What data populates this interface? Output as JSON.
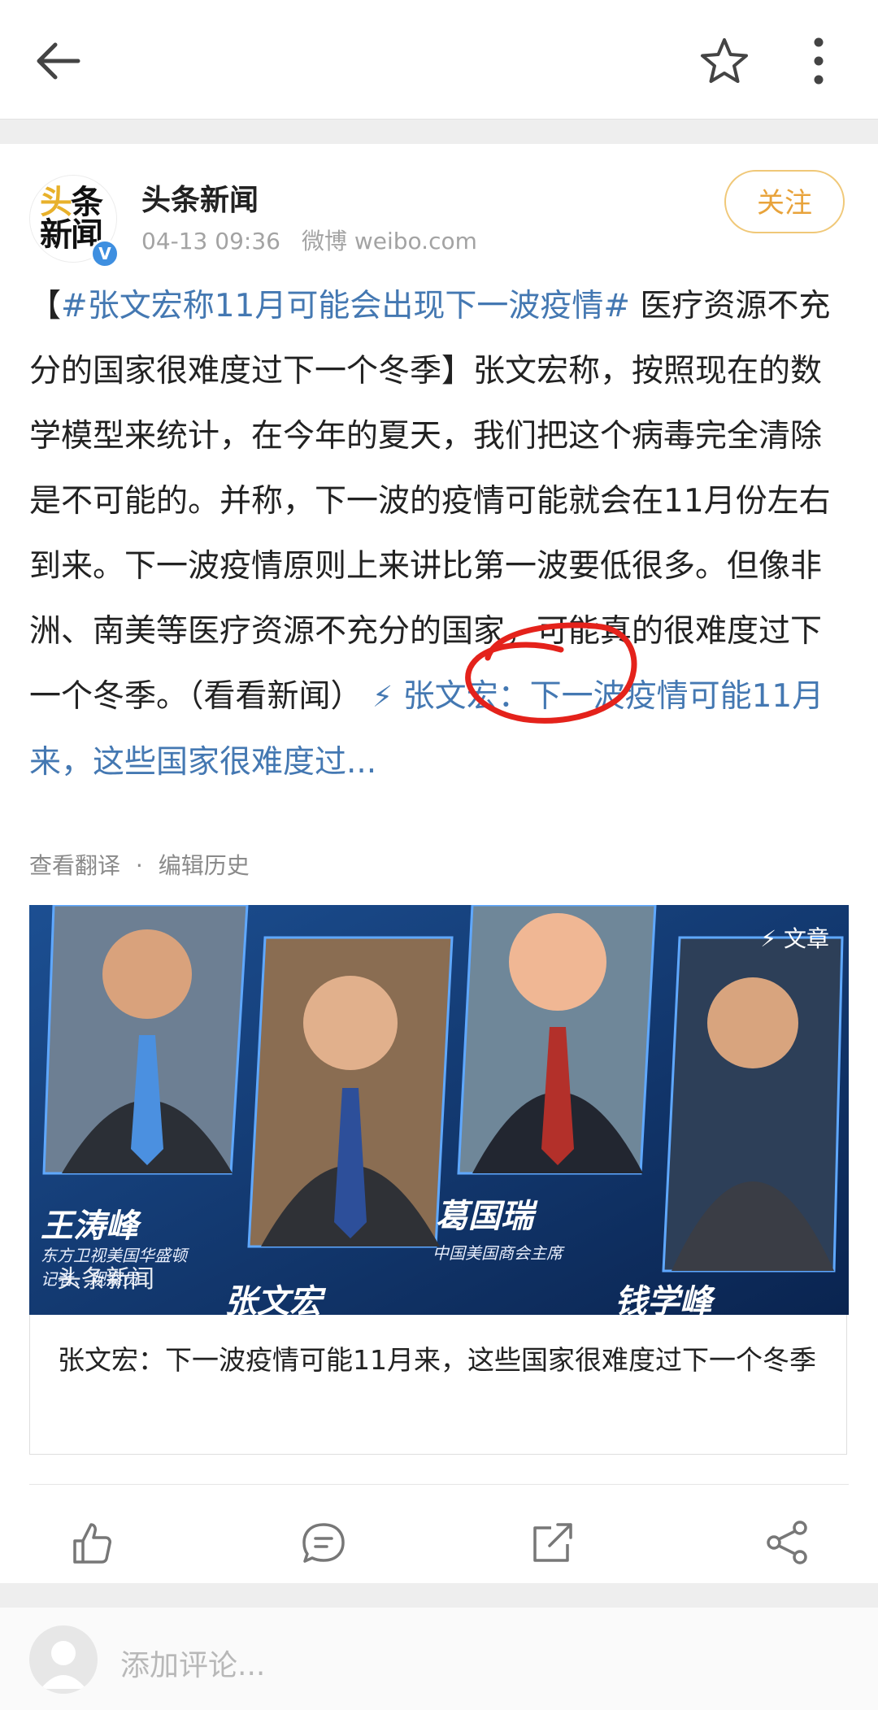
{
  "nav": {
    "back_icon": "arrow-left-icon",
    "favorite_icon": "star-icon",
    "more_icon": "more-vertical-icon"
  },
  "account": {
    "logo_line1_a": "头",
    "logo_line1_b": "条",
    "logo_line2": "新闻",
    "verified_badge": "V",
    "name": "头条新闻",
    "time": "04-13 09:36",
    "source": "微博 weibo.com",
    "follow_label": "关注"
  },
  "post": {
    "bracket_open": "【",
    "topic": "#张文宏称11月可能会出现下一波疫情#",
    "body": " 医疗资源不充分的国家很难度过下一个冬季】张文宏称，按照现在的数学模型来统计，在今年的夏天，我们把这个病毒完全清除是不可能的。并称，下一波的疫情可能就会在11月份左右到来。下一波疫情原则上来讲比第一波要低很多。但像非洲、南美等医疗资源不充分的国家，可能真的很难度过下一个冬季。（看看新闻） ",
    "link_text": "张文宏：下一波疫情可能11月来，这些国家很难度过..."
  },
  "post_actions": {
    "translate": "查看翻译",
    "separator": "·",
    "history": "编辑历史"
  },
  "card": {
    "tag": "文章",
    "names": [
      "王涛峰",
      "张文宏",
      "葛国瑞",
      "钱学峰"
    ],
    "roles": [
      "东方卫视美国华盛顿记者、观察员",
      "中国美国商会主席"
    ],
    "watermark": "头条新闻",
    "caption": "张文宏：下一波疫情可能11月来，这些国家很难度过下一个冬季"
  },
  "actions": {
    "icons": [
      "thumbs-up-icon",
      "comment-icon",
      "repost-icon",
      "share-icon"
    ]
  },
  "comment": {
    "placeholder": "添加评论..."
  },
  "colors": {
    "link": "#4478b2",
    "follow": "#e8a33b",
    "annotation": "#e4221b"
  }
}
